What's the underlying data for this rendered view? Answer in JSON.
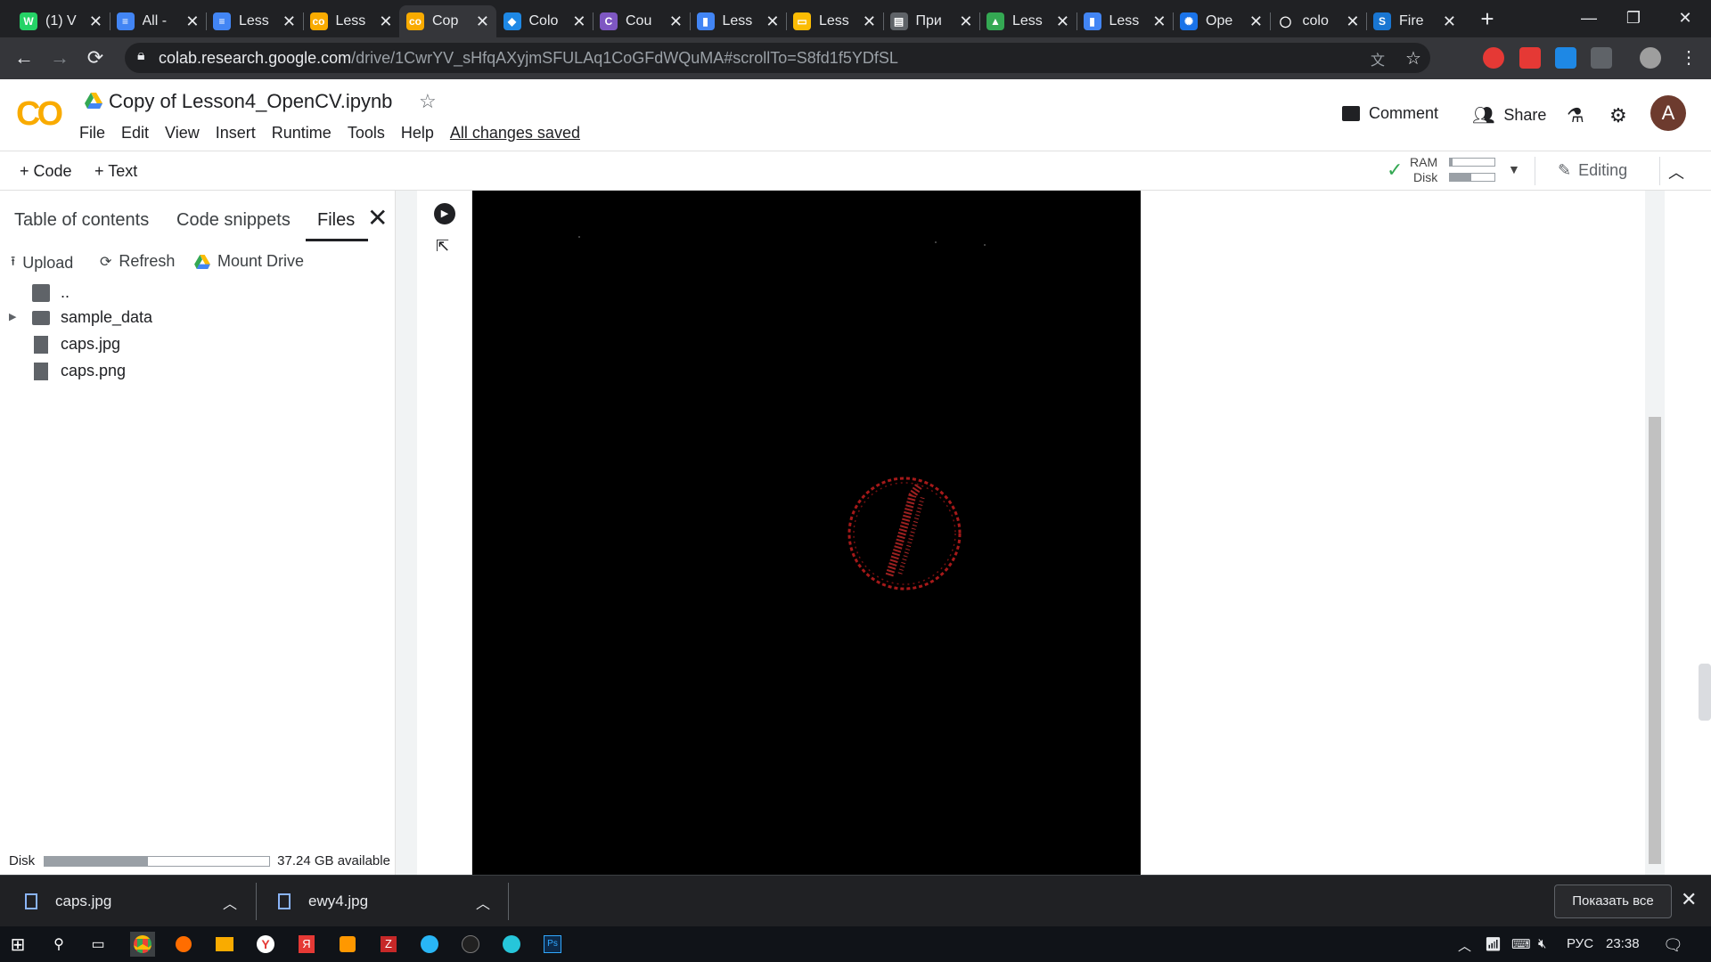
{
  "browser": {
    "tabs": [
      {
        "title": "(1) V",
        "color": "#25d366",
        "glyph": "W"
      },
      {
        "title": "All -",
        "color": "#4285f4",
        "glyph": "≡"
      },
      {
        "title": "Less",
        "color": "#4285f4",
        "glyph": "≡"
      },
      {
        "title": "Less",
        "color": "#f9ab00",
        "glyph": "co"
      },
      {
        "title": "Cop",
        "color": "#f9ab00",
        "glyph": "co"
      },
      {
        "title": "Colo",
        "color": "#1e88e5",
        "glyph": "◆"
      },
      {
        "title": "Cou",
        "color": "#7e57c2",
        "glyph": "C"
      },
      {
        "title": "Less",
        "color": "#4285f4",
        "glyph": "▮"
      },
      {
        "title": "Less",
        "color": "#fbbc04",
        "glyph": "▭"
      },
      {
        "title": "При",
        "color": "#5f6368",
        "glyph": "▤"
      },
      {
        "title": "Less",
        "color": "#34a853",
        "glyph": "▲"
      },
      {
        "title": "Less",
        "color": "#4285f4",
        "glyph": "▮"
      },
      {
        "title": "Ope",
        "color": "#1a73e8",
        "glyph": "✺"
      },
      {
        "title": "colo",
        "color": "#202124",
        "glyph": "◯"
      },
      {
        "title": "Fire",
        "color": "#1976d2",
        "glyph": "S"
      }
    ],
    "url_domain": "colab.research.google.com",
    "url_path": "/drive/1CwrYV_sHfqAXyjmSFULAq1CoGFdWQuMA#scrollTo=S8fd1f5YDfSL"
  },
  "colab": {
    "logo": "CO",
    "doc_title": "Copy of Lesson4_OpenCV.ipynb",
    "menu": [
      "File",
      "Edit",
      "View",
      "Insert",
      "Runtime",
      "Tools",
      "Help"
    ],
    "saved_status": "All changes saved",
    "comment_label": "Comment",
    "share_label": "Share",
    "avatar_letter": "A",
    "add_code": "Code",
    "add_text": "Text",
    "ram_label": "RAM",
    "disk_label": "Disk",
    "editing_label": "Editing"
  },
  "panel": {
    "tabs": [
      "Table of contents",
      "Code snippets",
      "Files"
    ],
    "actions": {
      "upload": "Upload",
      "refresh": "Refresh",
      "mount": "Mount Drive"
    },
    "files": [
      {
        "name": "..",
        "type": "parent"
      },
      {
        "name": "sample_data",
        "type": "folder"
      },
      {
        "name": "caps.jpg",
        "type": "file"
      },
      {
        "name": "caps.png",
        "type": "file"
      }
    ],
    "disk_label": "Disk",
    "disk_available": "37.24 GB available",
    "disk_used_fraction": 0.46
  },
  "downloads": {
    "items": [
      "caps.jpg",
      "ewy4.jpg"
    ],
    "show_all": "Показать все"
  },
  "taskbar": {
    "lang": "РУС",
    "time": "23:38"
  }
}
